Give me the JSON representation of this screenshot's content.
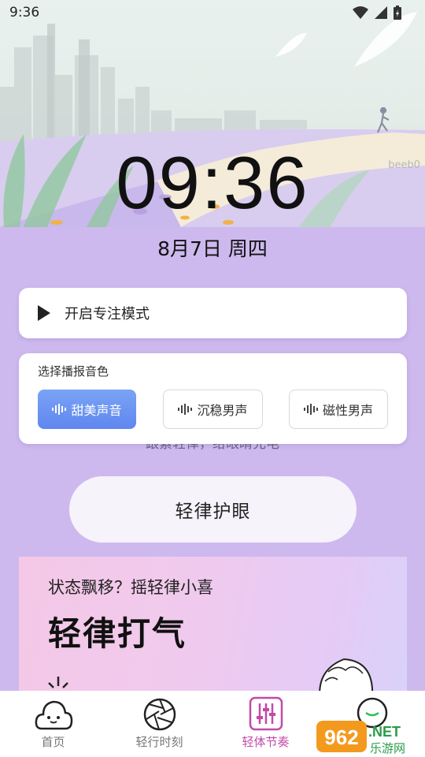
{
  "status_bar": {
    "time": "9:36"
  },
  "hero": {
    "watermark": "beeb0"
  },
  "clock": {
    "time": "09:36",
    "date": "8月7日 周四"
  },
  "focus": {
    "label": "开启专注模式"
  },
  "voice": {
    "title": "选择播报音色",
    "options": [
      {
        "label": "甜美声音",
        "selected": true
      },
      {
        "label": "沉稳男声",
        "selected": false
      },
      {
        "label": "磁性男声",
        "selected": false
      }
    ]
  },
  "behind_text": "跟紧轻律，给眼睛充电",
  "eye_button": {
    "label": "轻律护眼"
  },
  "promo": {
    "subtitle": "状态飘移？摇轻律小喜",
    "title": "轻律打气"
  },
  "tabs": [
    {
      "label": "首页",
      "active": false
    },
    {
      "label": "轻行时刻",
      "active": false
    },
    {
      "label": "轻体节奏",
      "active": true
    },
    {
      "label": "",
      "active": false
    }
  ],
  "overlay_watermark": {
    "number": "962",
    "suffix": ".NET",
    "caption": "乐游网"
  },
  "colors": {
    "accent": "#c24aa8",
    "voice_selected": "#6b93f2",
    "background": "#cdb9ee"
  }
}
